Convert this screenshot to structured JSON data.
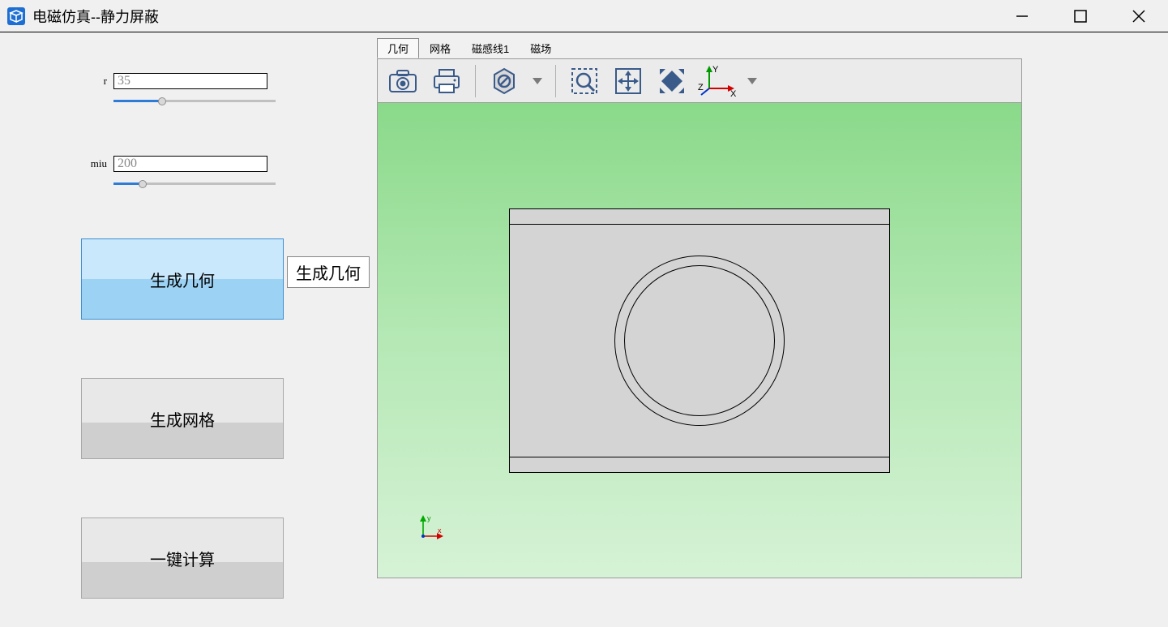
{
  "window": {
    "title": "电磁仿真--静力屏蔽"
  },
  "params": {
    "r_label": "r",
    "r_value": "35",
    "miu_label": "miu",
    "miu_value": "200"
  },
  "buttons": {
    "gen_geom": "生成几何",
    "gen_mesh": "生成网格",
    "compute": "一键计算"
  },
  "tooltip": "生成几何",
  "tabs": {
    "geom": "几何",
    "mesh": "网格",
    "flux": "磁感线1",
    "field": "磁场"
  },
  "axes": {
    "x": "X",
    "y": "Y",
    "z": "Z",
    "small_x": "x",
    "small_y": "y"
  }
}
